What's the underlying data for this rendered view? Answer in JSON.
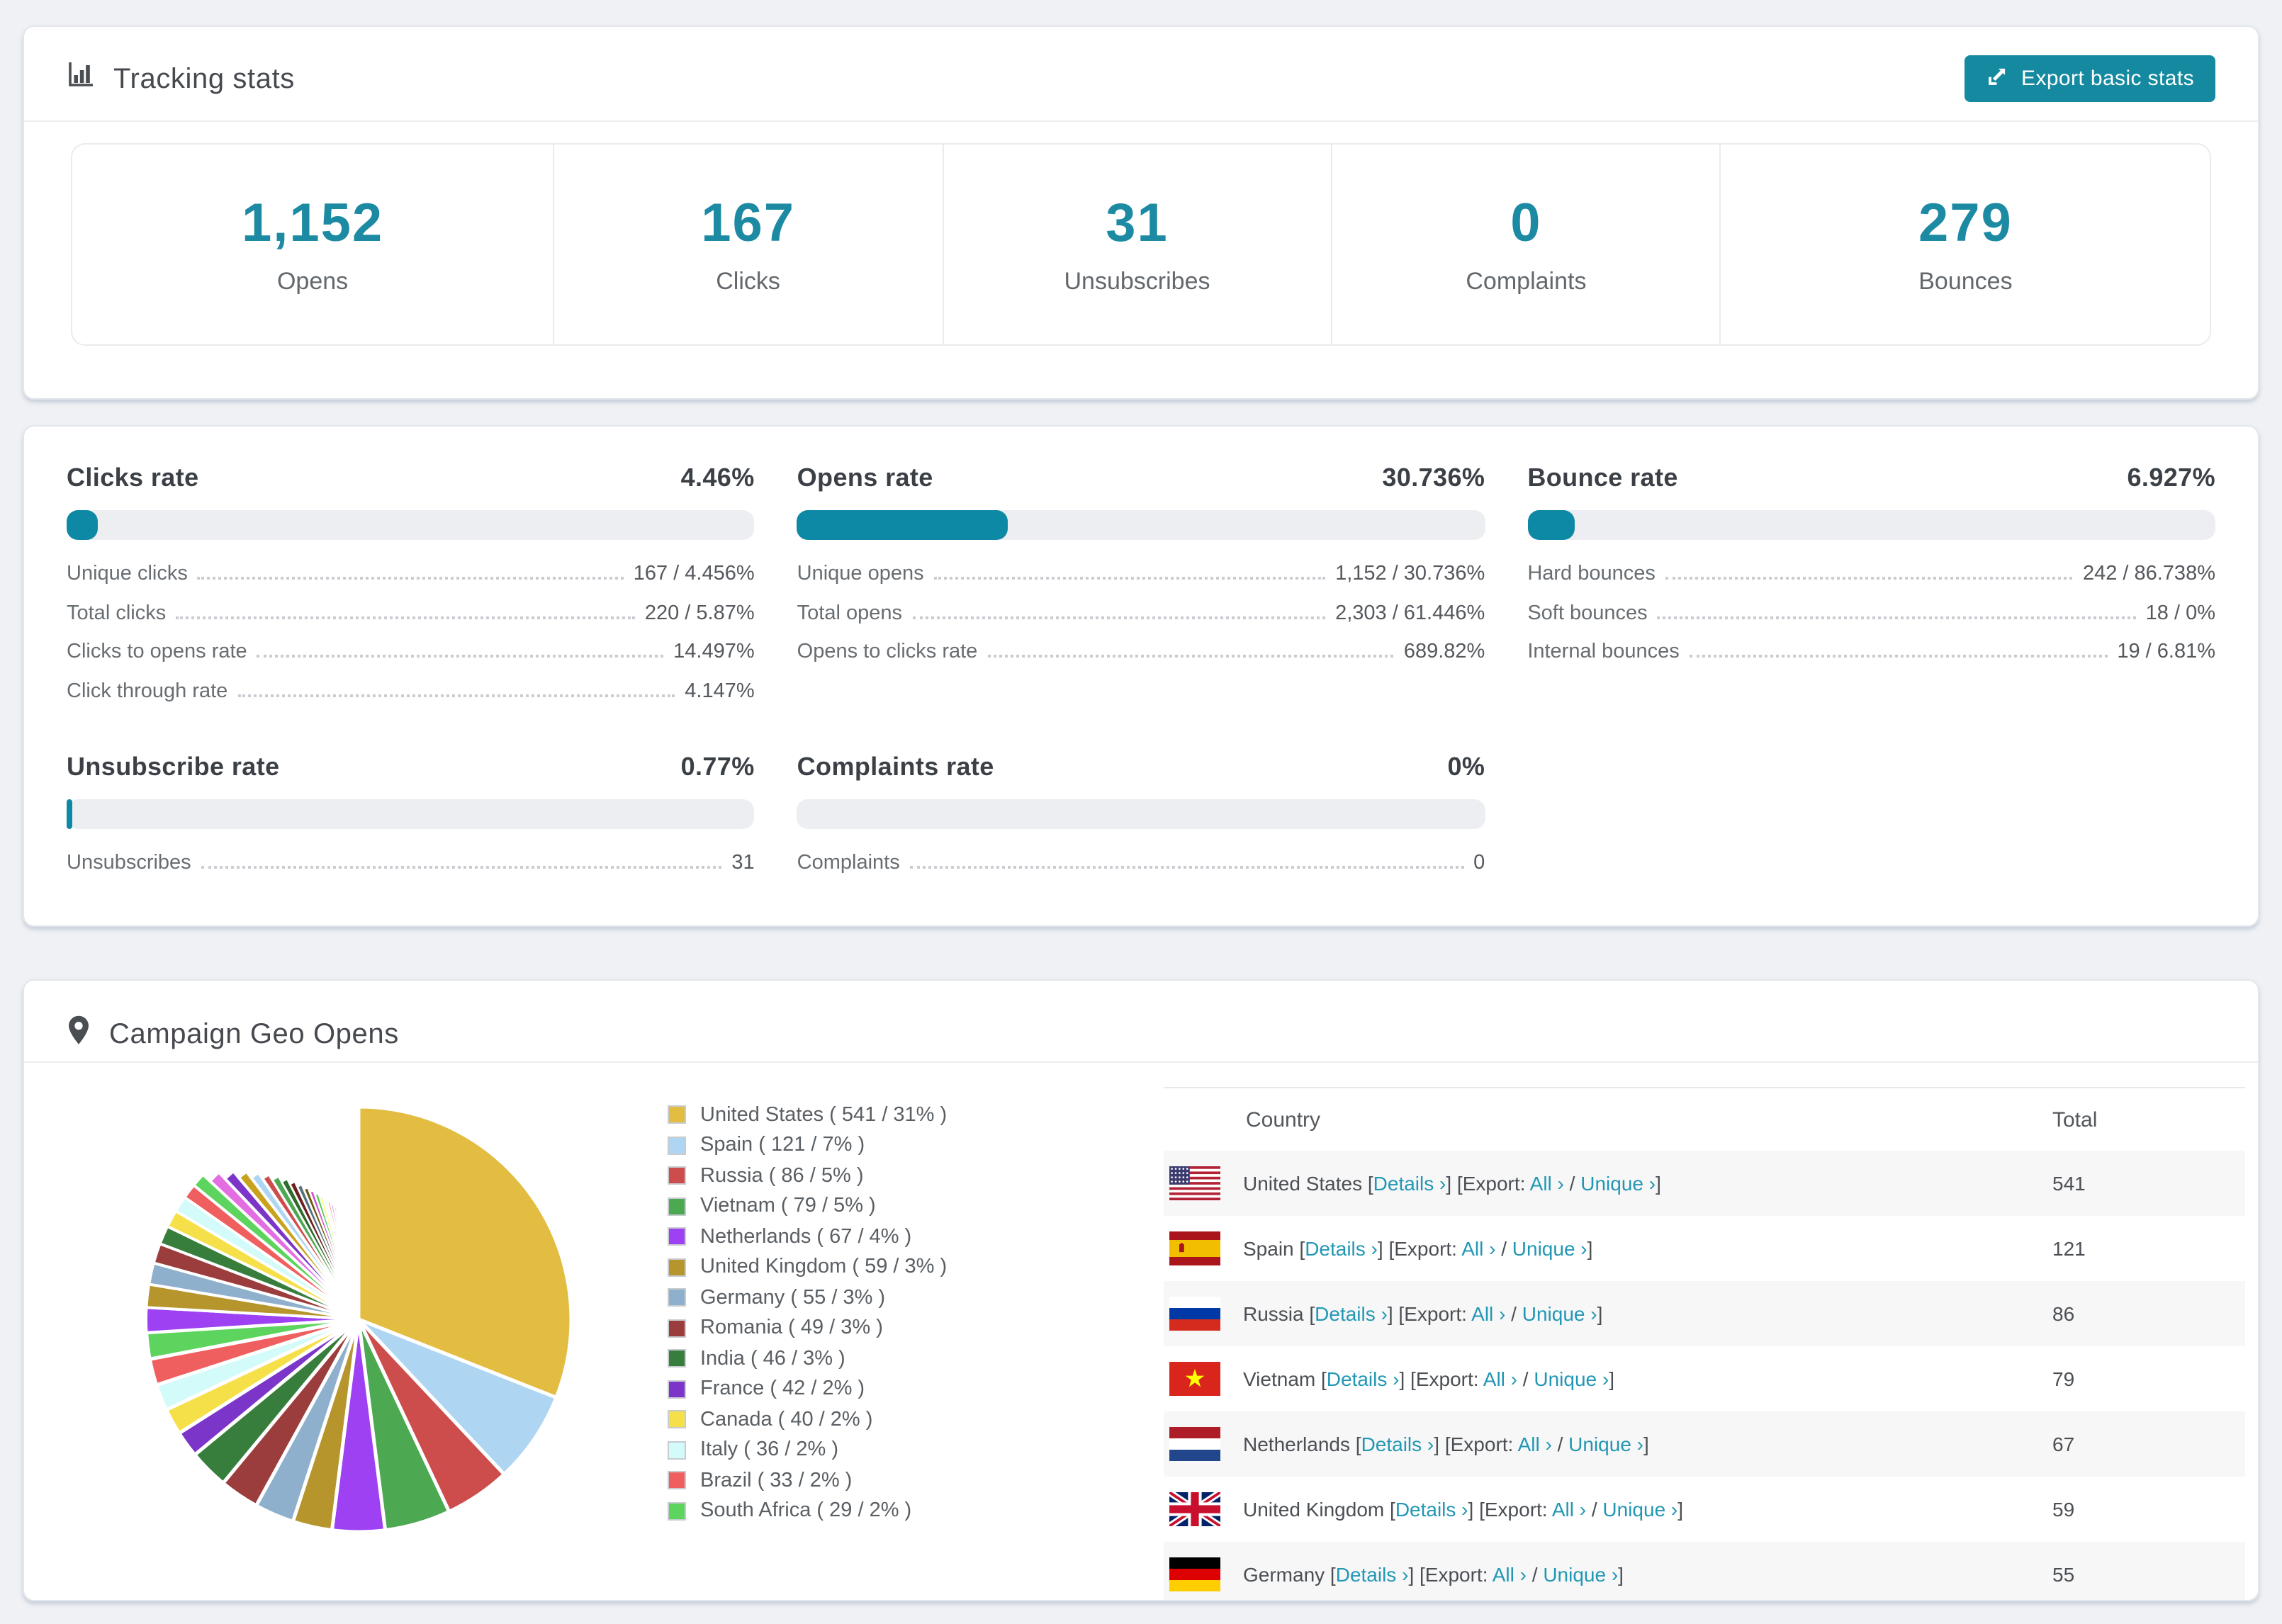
{
  "app": {
    "accent": "#1189a3",
    "button_color": "#1489a0",
    "link_color": "#2297b4"
  },
  "tracking": {
    "title": "Tracking stats",
    "export_button_label": "Export basic stats",
    "summary": [
      {
        "value": "1,152",
        "label": "Opens"
      },
      {
        "value": "167",
        "label": "Clicks"
      },
      {
        "value": "31",
        "label": "Unsubscribes"
      },
      {
        "value": "0",
        "label": "Complaints"
      },
      {
        "value": "279",
        "label": "Bounces"
      }
    ]
  },
  "rates": [
    {
      "title": "Clicks rate",
      "value": "4.46%",
      "percent": 4.46,
      "stats": [
        {
          "label": "Unique clicks",
          "value": "167 / 4.456%"
        },
        {
          "label": "Total clicks",
          "value": "220 / 5.87%"
        },
        {
          "label": "Clicks to opens rate",
          "value": "14.497%"
        },
        {
          "label": "Click through rate",
          "value": "4.147%"
        }
      ]
    },
    {
      "title": "Opens rate",
      "value": "30.736%",
      "percent": 30.736,
      "stats": [
        {
          "label": "Unique opens",
          "value": "1,152 / 30.736%"
        },
        {
          "label": "Total opens",
          "value": "2,303 / 61.446%"
        },
        {
          "label": "Opens to clicks rate",
          "value": "689.82%"
        }
      ]
    },
    {
      "title": "Bounce rate",
      "value": "6.927%",
      "percent": 6.927,
      "stats": [
        {
          "label": "Hard bounces",
          "value": "242 / 86.738%"
        },
        {
          "label": "Soft bounces",
          "value": "18 / 0%"
        },
        {
          "label": "Internal bounces",
          "value": "19 / 6.81%"
        }
      ]
    },
    {
      "title": "Unsubscribe rate",
      "value": "0.77%",
      "percent": 0.77,
      "stats": [
        {
          "label": "Unsubscribes",
          "value": "31"
        }
      ]
    },
    {
      "title": "Complaints rate",
      "value": "0%",
      "percent": 0,
      "stats": [
        {
          "label": "Complaints",
          "value": "0"
        }
      ]
    }
  ],
  "geo": {
    "title": "Campaign Geo Opens",
    "table": {
      "columns": [
        "Country",
        "Total"
      ],
      "link_labels": {
        "details": "Details",
        "export": "Export:",
        "all": "All",
        "unique": "Unique",
        "chevron": "›"
      },
      "rows": [
        {
          "country": "United States",
          "flag": "us",
          "total": "541"
        },
        {
          "country": "Spain",
          "flag": "es",
          "total": "121"
        },
        {
          "country": "Russia",
          "flag": "ru",
          "total": "86"
        },
        {
          "country": "Vietnam",
          "flag": "vn",
          "total": "79"
        },
        {
          "country": "Netherlands",
          "flag": "nl",
          "total": "67"
        },
        {
          "country": "United Kingdom",
          "flag": "gb",
          "total": "59"
        },
        {
          "country": "Germany",
          "flag": "de",
          "total": "55",
          "partially_visible": true
        }
      ]
    }
  },
  "chart_data": {
    "type": "pie",
    "title": "Campaign Geo Opens",
    "categories": [
      "United States",
      "Spain",
      "Russia",
      "Vietnam",
      "Netherlands",
      "United Kingdom",
      "Germany",
      "Romania",
      "India",
      "France",
      "Canada",
      "Italy",
      "Brazil",
      "South Africa"
    ],
    "values": [
      541,
      121,
      86,
      79,
      67,
      59,
      55,
      49,
      46,
      42,
      40,
      36,
      33,
      29
    ],
    "percents": [
      31,
      7,
      5,
      5,
      4,
      3,
      3,
      3,
      3,
      2,
      2,
      2,
      2,
      2
    ],
    "colors": [
      "#e3bc42",
      "#aed5f2",
      "#cd4d4d",
      "#4da852",
      "#9d41f3",
      "#b5952c",
      "#8fb0cc",
      "#9c3d3d",
      "#377d3b",
      "#7c35c9",
      "#f6e049",
      "#d2fbf9",
      "#f05f5f",
      "#5dd45d"
    ],
    "legend_position": "right",
    "start_angle_deg": 0,
    "direction": "clockwise",
    "other_small_slices_total_percent": 26
  }
}
